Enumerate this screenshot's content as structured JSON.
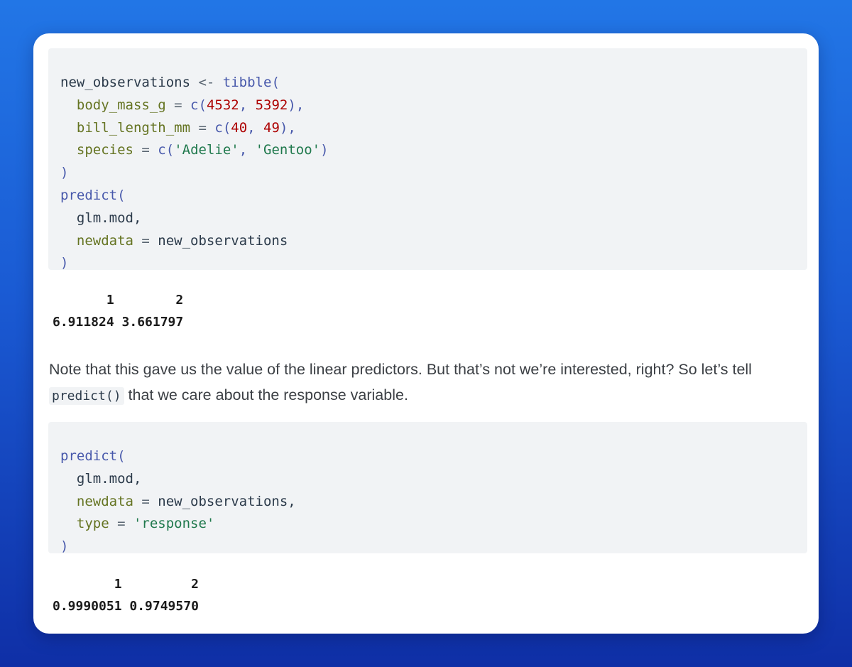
{
  "code_block_1": {
    "line_1": {
      "var": "new_observations",
      "op": " <- ",
      "fn": "tibble",
      "punc": "("
    },
    "line_2": {
      "arg": "  body_mass_g",
      "op": " = ",
      "fn": "c",
      "p1": "(",
      "n1": "4532",
      "sep": ", ",
      "n2": "5392",
      "p2": "),",
      "tail": ""
    },
    "line_3": {
      "arg": "  bill_length_mm",
      "op": " = ",
      "fn": "c",
      "p1": "(",
      "n1": "40",
      "sep": ", ",
      "n2": "49",
      "p2": "),",
      "tail": ""
    },
    "line_4": {
      "arg": "  species",
      "op": " = ",
      "fn": "c",
      "p1": "(",
      "s1": "'Adelie'",
      "sep": ", ",
      "s2": "'Gentoo'",
      "p2": ")"
    },
    "line_5": {
      "punc": ")"
    },
    "line_6": {
      "fn": "predict",
      "punc": "("
    },
    "line_7": {
      "var": "  glm.mod,",
      "punc": ""
    },
    "line_8": {
      "arg": "  newdata",
      "op": " = ",
      "var": "new_observations"
    },
    "line_9": {
      "punc": ")"
    }
  },
  "output_1": {
    "header": "       1        2",
    "values": "6.911824 3.661797"
  },
  "prose": {
    "text_before": "Note that this gave us the value of the linear predictors. But that’s not we’re interested, right? So let’s tell ",
    "inline_code": "predict()",
    "text_after": " that we care about the response variable."
  },
  "code_block_2": {
    "line_1": {
      "fn": "predict",
      "punc": "("
    },
    "line_2": {
      "var": "  glm.mod,"
    },
    "line_3": {
      "arg": "  newdata",
      "op": " = ",
      "var": "new_observations,",
      "punc": ""
    },
    "line_4": {
      "arg": "  type",
      "op": " = ",
      "str": "'response'"
    },
    "line_5": {
      "punc": ")"
    }
  },
  "output_2": {
    "header": "        1         2",
    "values": "0.9990051 0.9749570"
  }
}
